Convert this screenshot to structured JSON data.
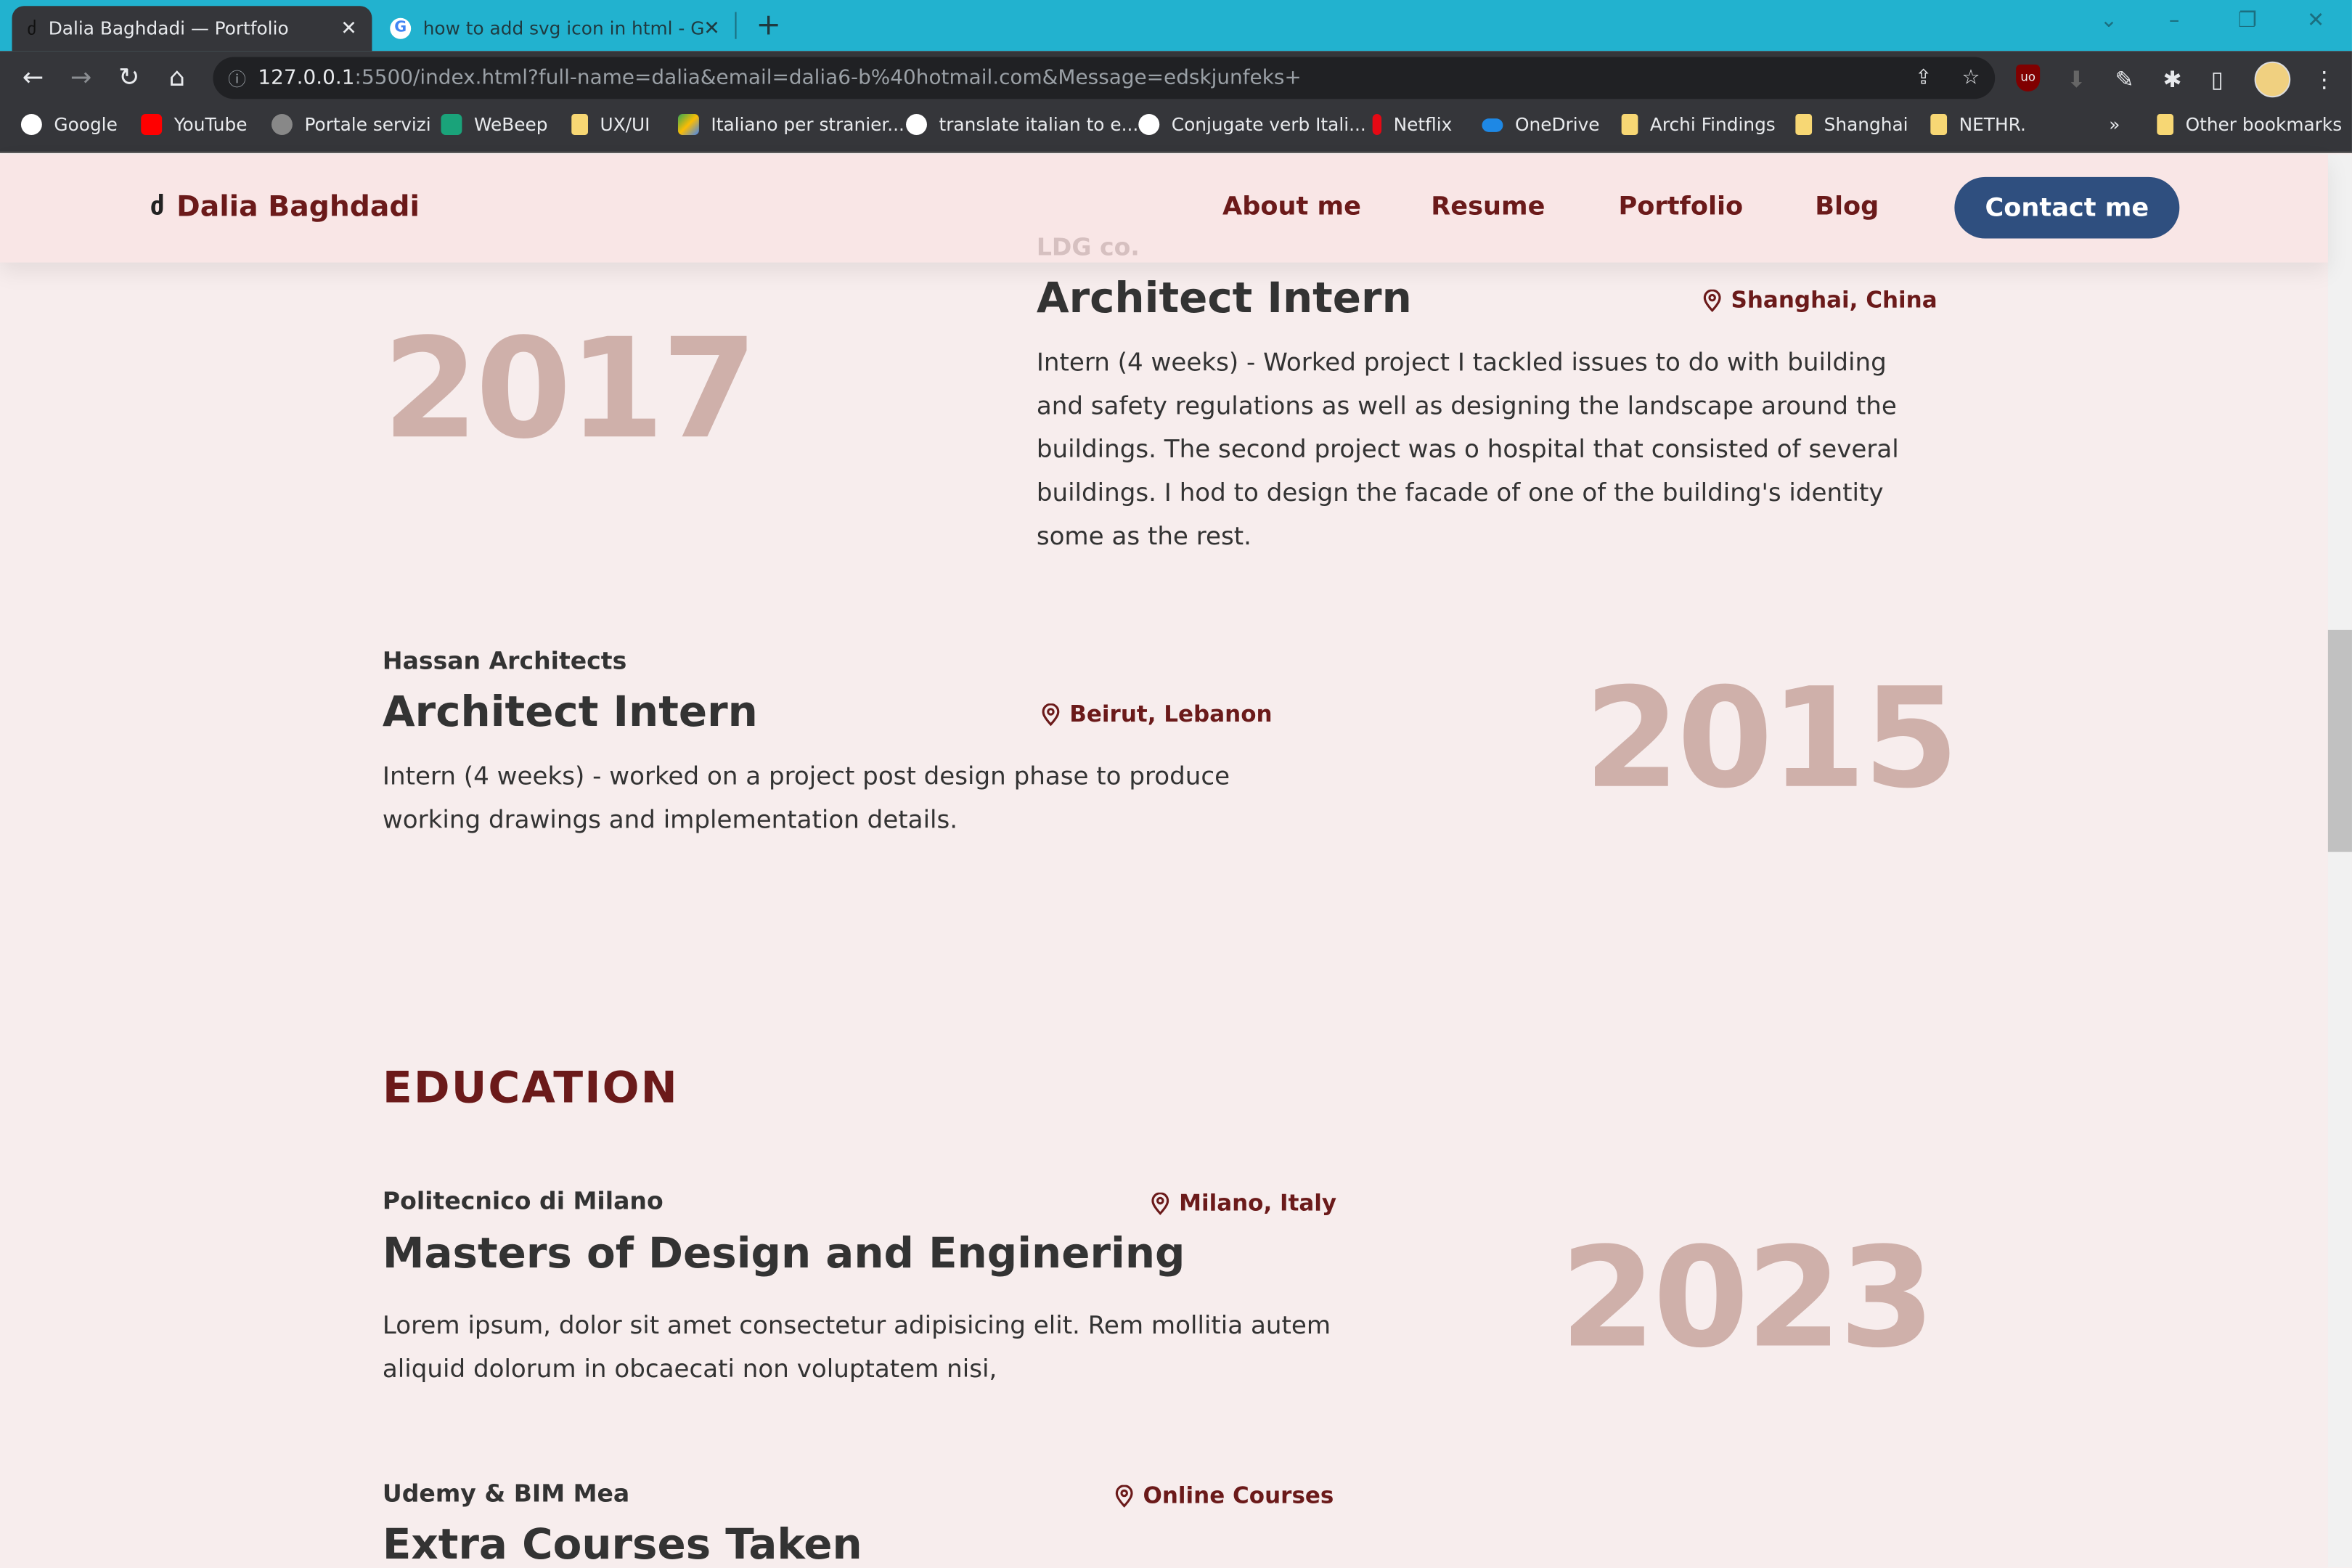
{
  "browser": {
    "tabs": [
      {
        "title": "Dalia Baghdadi — Portfolio",
        "active": true
      },
      {
        "title": "how to add svg icon in html - Go",
        "active": false
      }
    ],
    "new_tab": "+",
    "url_host": "127.0.0.1",
    "url_rest": ":5500/index.html?full-name=dalia&email=dalia6-b%40hotmail.com&Message=edskjunfeks+",
    "bookmarks": [
      {
        "label": "Google",
        "icon": "google-icon",
        "color": "#ffffff"
      },
      {
        "label": "YouTube",
        "icon": "youtube-icon",
        "color": "#ff0000"
      },
      {
        "label": "Portale servizi",
        "icon": "globe-icon",
        "color": "#888888"
      },
      {
        "label": "WeBeep",
        "icon": "check-icon",
        "color": "#1aa37a"
      },
      {
        "label": "UX/UI",
        "icon": "folder-icon",
        "color": "#f7d774"
      },
      {
        "label": "Italiano per stranier...",
        "icon": "drive-icon",
        "color": "#34a853"
      },
      {
        "label": "translate italian to e...",
        "icon": "google-icon",
        "color": "#ffffff"
      },
      {
        "label": "Conjugate verb Itali...",
        "icon": "reverso-icon",
        "color": "#ffffff"
      },
      {
        "label": "Netflix",
        "icon": "netflix-icon",
        "color": "#e50914"
      },
      {
        "label": "OneDrive",
        "icon": "onedrive-icon",
        "color": "#1e88e5"
      },
      {
        "label": "Archi Findings",
        "icon": "folder-icon",
        "color": "#f7d774"
      },
      {
        "label": "Shanghai",
        "icon": "folder-icon",
        "color": "#f7d774"
      },
      {
        "label": "NETHR.",
        "icon": "folder-icon",
        "color": "#f7d774"
      }
    ],
    "more": "»",
    "other_bookmarks": "Other bookmarks"
  },
  "nav": {
    "brand": "Dalia Baghdadi",
    "links": [
      "About me",
      "Resume",
      "Portfolio",
      "Blog"
    ],
    "contact": "Contact me"
  },
  "experience": [
    {
      "company": "LDG co.",
      "role": "Architect Intern",
      "location": "Shanghai, China",
      "year": "2017",
      "desc": "Intern (4 weeks) - Worked project I tackled issues to do with building and safety regulations as well as designing the landscape around the buildings. The second project was o hospital that consisted of several buildings. I hod to design the facade of one of the building's identity some as the rest."
    },
    {
      "company": "Hassan Architects",
      "role": "Architect Intern",
      "location": "Beirut, Lebanon",
      "year": "2015",
      "desc": "Intern (4 weeks) - worked on a project post design phase to produce working drawings and implementation details."
    }
  ],
  "education": {
    "title": "EDUCATION",
    "items": [
      {
        "school": "Politecnico di Milano",
        "location": "Milano, Italy",
        "degree": "Masters of Design and Enginering",
        "year": "2023",
        "desc": "Lorem ipsum, dolor sit amet consectetur adipisicing elit. Rem mollitia autem aliquid dolorum in obcaecati non voluptatem nisi,"
      },
      {
        "school": "Udemy & BIM Mea",
        "location": "Online Courses",
        "degree": "Extra Courses Taken"
      }
    ]
  },
  "colors": {
    "accent": "#6b1a1a",
    "button": "#2f4f7f",
    "year": "#cfb0aa",
    "background": "#f7eded",
    "tabbar": "#22b2cf"
  }
}
